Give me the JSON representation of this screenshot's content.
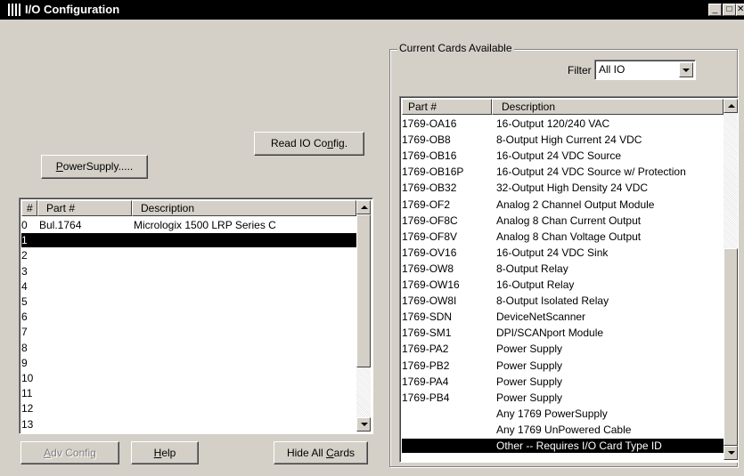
{
  "window": {
    "title": "I/O Configuration",
    "controls": [
      "_",
      "□",
      "✕"
    ]
  },
  "buttons": {
    "read_io_config": {
      "pre": "Read IO Co",
      "u": "n",
      "post": "fig."
    },
    "power_supply": {
      "pre": "",
      "u": "P",
      "post": "owerSupply....."
    },
    "adv_config": {
      "pre": "",
      "u": "A",
      "post": "dv Config"
    },
    "help": {
      "pre": "",
      "u": "H",
      "post": "elp"
    },
    "hide_all_cards": {
      "pre": "Hide All ",
      "u": "C",
      "post": "ards"
    }
  },
  "slot_table": {
    "headers": [
      "#",
      "Part #",
      "Description"
    ],
    "rows": [
      {
        "num": "0",
        "part": "Bul.1764",
        "desc": "Micrologix 1500 LRP Series C"
      },
      {
        "num": "1",
        "part": "",
        "desc": "",
        "selected": true
      },
      {
        "num": "2",
        "part": "",
        "desc": ""
      },
      {
        "num": "3",
        "part": "",
        "desc": ""
      },
      {
        "num": "4",
        "part": "",
        "desc": ""
      },
      {
        "num": "5",
        "part": "",
        "desc": ""
      },
      {
        "num": "6",
        "part": "",
        "desc": ""
      },
      {
        "num": "7",
        "part": "",
        "desc": ""
      },
      {
        "num": "8",
        "part": "",
        "desc": ""
      },
      {
        "num": "9",
        "part": "",
        "desc": ""
      },
      {
        "num": "10",
        "part": "",
        "desc": ""
      },
      {
        "num": "11",
        "part": "",
        "desc": ""
      },
      {
        "num": "12",
        "part": "",
        "desc": ""
      },
      {
        "num": "13",
        "part": "",
        "desc": ""
      }
    ]
  },
  "cards_panel": {
    "group_label": "Current Cards Available",
    "filter_label": "Filter",
    "filter_value": "All IO",
    "headers": [
      "Part #",
      "Description"
    ],
    "rows": [
      {
        "part": "1769-OA16",
        "desc": "16-Output 120/240 VAC"
      },
      {
        "part": "1769-OB8",
        "desc": "8-Output High Current 24 VDC"
      },
      {
        "part": "1769-OB16",
        "desc": "16-Output 24 VDC Source"
      },
      {
        "part": "1769-OB16P",
        "desc": "16-Output 24 VDC Source w/ Protection"
      },
      {
        "part": "1769-OB32",
        "desc": "32-Output High Density 24 VDC"
      },
      {
        "part": "1769-OF2",
        "desc": "Analog  2 Channel Output Module"
      },
      {
        "part": "1769-OF8C",
        "desc": "Analog 8 Chan Current Output"
      },
      {
        "part": "1769-OF8V",
        "desc": "Analog 8 Chan Voltage Output"
      },
      {
        "part": "1769-OV16",
        "desc": "16-Output 24 VDC Sink"
      },
      {
        "part": "1769-OW8",
        "desc": "8-Output Relay"
      },
      {
        "part": "1769-OW16",
        "desc": "16-Output Relay"
      },
      {
        "part": "1769-OW8I",
        "desc": " 8-Output Isolated Relay"
      },
      {
        "part": "1769-SDN",
        "desc": "DeviceNetScanner"
      },
      {
        "part": "1769-SM1",
        "desc": "DPI/SCANport Module"
      },
      {
        "part": "1769-PA2",
        "desc": "Power Supply"
      },
      {
        "part": "1769-PB2",
        "desc": "Power Supply"
      },
      {
        "part": "1769-PA4",
        "desc": "Power Supply"
      },
      {
        "part": "1769-PB4",
        "desc": "Power Supply"
      },
      {
        "part": "",
        "desc": "Any 1769 PowerSupply"
      },
      {
        "part": "",
        "desc": "Any 1769 UnPowered Cable"
      },
      {
        "part": "",
        "desc": "Other -- Requires I/O Card Type ID",
        "selected": true
      }
    ]
  }
}
